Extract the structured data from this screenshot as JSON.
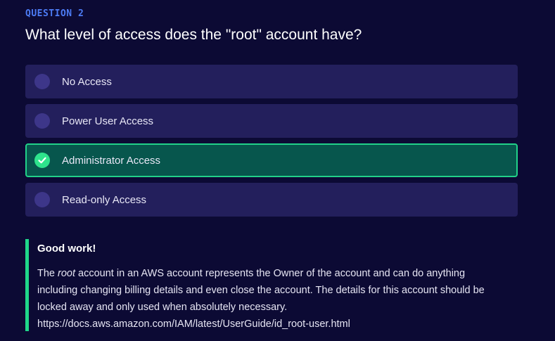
{
  "question": {
    "label": "QUESTION 2",
    "text": "What level of access does the \"root\" account have?"
  },
  "options": [
    {
      "label": "No Access",
      "state": "unselected"
    },
    {
      "label": "Power User Access",
      "state": "unselected"
    },
    {
      "label": "Administrator Access",
      "state": "correct"
    },
    {
      "label": "Read-only Access",
      "state": "unselected"
    }
  ],
  "feedback": {
    "title": "Good work!",
    "body_prefix": "The ",
    "body_emphasis": "root",
    "body_suffix": " account in an AWS account represents the Owner of the account and can do anything including changing billing details and even close the account. The details for this account should be locked away and only used when absolutely necessary.",
    "link": "https://docs.aws.amazon.com/IAM/latest/UserGuide/id_root-user.html"
  },
  "colors": {
    "background": "#0c0a34",
    "accent": "#4d7cf6",
    "option_bg": "#231f5c",
    "correct_bg": "#07564d",
    "correct_border": "#21d189",
    "feedback_border": "#1fd68a"
  },
  "icons": {
    "correct": "check-circle-icon",
    "unselected": "radio-circle-icon"
  }
}
